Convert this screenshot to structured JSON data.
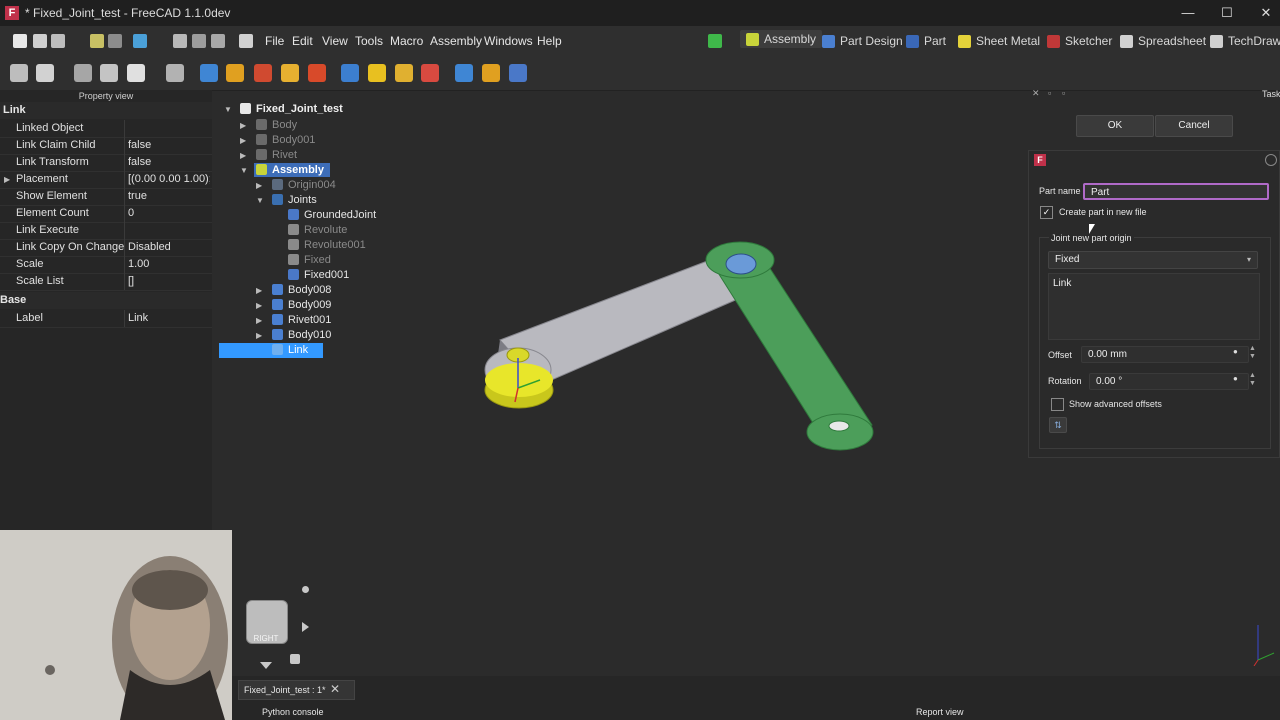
{
  "window": {
    "title": "* Fixed_Joint_test - FreeCAD 1.1.0dev",
    "minimize": "—",
    "maximize": "☐",
    "close": "✕"
  },
  "menu": [
    "File",
    "Edit",
    "View",
    "Tools",
    "Macro",
    "Assembly",
    "Windows",
    "Help"
  ],
  "workbenches": [
    {
      "label": "Assembly",
      "color": "#c8d43a"
    },
    {
      "label": "Part Design",
      "color": "#4a7fd0"
    },
    {
      "label": "Part",
      "color": "#3a68b8"
    },
    {
      "label": "Sheet Metal",
      "color": "#e4d23a"
    },
    {
      "label": "Sketcher",
      "color": "#c03838"
    },
    {
      "label": "Spreadsheet",
      "color": "#d0d0d0"
    },
    {
      "label": "TechDraw",
      "color": "#cfcfcf"
    }
  ],
  "property_view": {
    "header": "Property view",
    "group_link": "Link",
    "rows": [
      {
        "k": "Linked Object",
        "v": ""
      },
      {
        "k": "Link Claim Child",
        "v": "false"
      },
      {
        "k": "Link Transform",
        "v": "false"
      },
      {
        "k": "Placement",
        "v": "[(0.00 0.00 1.00);..."
      },
      {
        "k": "Show Element",
        "v": "true"
      },
      {
        "k": "Element Count",
        "v": "0"
      },
      {
        "k": "Link Execute",
        "v": ""
      },
      {
        "k": "Link Copy On Change",
        "v": "Disabled"
      },
      {
        "k": "Scale",
        "v": "1.00"
      },
      {
        "k": "Scale List",
        "v": "[]"
      }
    ],
    "group_base": "Base",
    "base_rows": [
      {
        "k": "Label",
        "v": "Link"
      }
    ]
  },
  "tree": {
    "root": "Fixed_Joint_test",
    "items": [
      "Body",
      "Body001",
      "Rivet",
      "Assembly",
      "Origin004",
      "Joints",
      "GroundedJoint",
      "Revolute",
      "Revolute001",
      "Fixed",
      "Fixed001",
      "Body008",
      "Body009",
      "Rivet001",
      "Body010",
      "Link"
    ]
  },
  "tasks": {
    "header": "Tasks",
    "ok": "OK",
    "cancel": "Cancel",
    "part_name_label": "Part name",
    "part_name_value": "Part",
    "create_new_file": "Create part in new file",
    "origin_group": "Joint new part origin",
    "origin_select": "Fixed",
    "origin_list_item": "Link",
    "offset_label": "Offset",
    "offset_value": "0.00 mm",
    "rotation_label": "Rotation",
    "rotation_value": "0.00 °",
    "advanced": "Show advanced offsets"
  },
  "navcube": {
    "face": "RIGHT"
  },
  "document_tab": "Fixed_Joint_test : 1*",
  "bottom": {
    "python_console": "Python console",
    "report_view": "Report view"
  }
}
